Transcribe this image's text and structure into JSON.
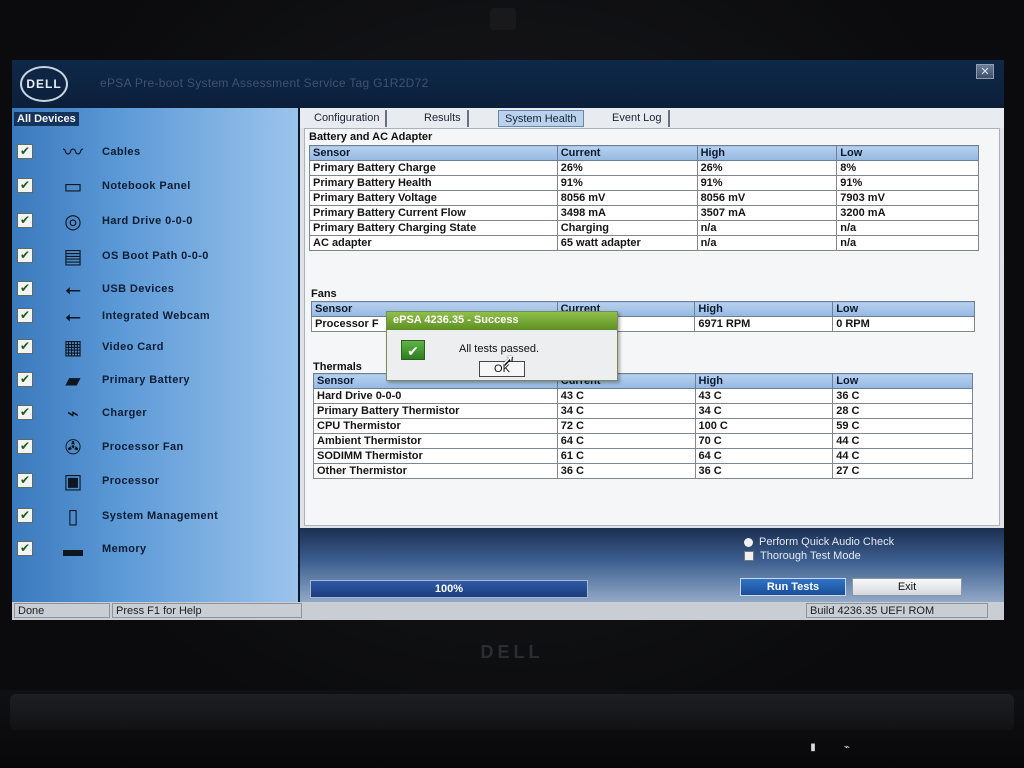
{
  "window": {
    "title": "ePSA Pre-boot System Assessment   Service Tag G1R2D72",
    "logo_text": "DELL",
    "close_icon": "close-icon"
  },
  "sidebar": {
    "header": "All Devices",
    "items": [
      {
        "label": "Cables",
        "icon": "cable-icon",
        "checked": true
      },
      {
        "label": "Notebook Panel",
        "icon": "notebook-panel-icon",
        "checked": true
      },
      {
        "label": "Hard Drive 0-0-0",
        "icon": "hard-drive-icon",
        "checked": true
      },
      {
        "label": "OS Boot Path 0-0-0",
        "icon": "boot-path-icon",
        "checked": true
      },
      {
        "label": "USB Devices",
        "icon": "usb-icon",
        "checked": true
      },
      {
        "label": "Integrated Webcam",
        "icon": "usb-icon",
        "checked": true
      },
      {
        "label": "Video Card",
        "icon": "video-card-icon",
        "checked": true
      },
      {
        "label": "Primary Battery",
        "icon": "battery-icon",
        "checked": true
      },
      {
        "label": "Charger",
        "icon": "charger-icon",
        "checked": true
      },
      {
        "label": "Processor Fan",
        "icon": "fan-icon",
        "checked": true
      },
      {
        "label": "Processor",
        "icon": "processor-icon",
        "checked": true
      },
      {
        "label": "System Management",
        "icon": "system-management-icon",
        "checked": true
      },
      {
        "label": "Memory",
        "icon": "memory-icon",
        "checked": true
      }
    ]
  },
  "tabs": [
    {
      "label": "Configuration",
      "active": false
    },
    {
      "label": "Results",
      "active": false
    },
    {
      "label": "System Health",
      "active": true
    },
    {
      "label": "Event Log",
      "active": false
    }
  ],
  "battery": {
    "title": "Battery and AC Adapter",
    "columns": [
      "Sensor",
      "Current",
      "High",
      "Low"
    ],
    "rows": [
      [
        "Primary Battery Charge",
        "26%",
        "26%",
        "8%"
      ],
      [
        "Primary Battery Health",
        "91%",
        "91%",
        "91%"
      ],
      [
        "Primary Battery Voltage",
        "8056 mV",
        "8056 mV",
        "7903 mV"
      ],
      [
        "Primary Battery Current Flow",
        "3498 mA",
        "3507 mA",
        "3200 mA"
      ],
      [
        "Primary Battery Charging State",
        "Charging",
        "n/a",
        "n/a"
      ],
      [
        "AC adapter",
        "65 watt adapter",
        "n/a",
        "n/a"
      ]
    ]
  },
  "fans": {
    "title": "Fans",
    "columns": [
      "Sensor",
      "Current",
      "High",
      "Low"
    ],
    "rows": [
      [
        "Processor F",
        "",
        "6971 RPM",
        "0 RPM"
      ]
    ]
  },
  "thermals": {
    "title": "Thermals",
    "columns": [
      "Sensor",
      "Current",
      "High",
      "Low"
    ],
    "rows": [
      [
        "Hard Drive 0-0-0",
        "43 C",
        "43 C",
        "36 C"
      ],
      [
        "Primary Battery Thermistor",
        "34 C",
        "34 C",
        "28 C"
      ],
      [
        "CPU Thermistor",
        "72 C",
        "100 C",
        "59 C"
      ],
      [
        "Ambient Thermistor",
        "64 C",
        "70 C",
        "44 C"
      ],
      [
        "SODIMM Thermistor",
        "61 C",
        "64 C",
        "44 C"
      ],
      [
        "Other Thermistor",
        "36 C",
        "36 C",
        "27 C"
      ]
    ]
  },
  "dialog": {
    "title": "ePSA 4236.35 - Success",
    "message": "All tests passed.",
    "ok_label": "OK",
    "icon": "success-check-icon"
  },
  "options": {
    "quick_audio": "Perform Quick Audio Check",
    "thorough": "Thorough Test Mode"
  },
  "progress": {
    "text": "100%",
    "value": 1.0
  },
  "buttons": {
    "run_tests": "Run Tests",
    "exit": "Exit"
  },
  "statusbar": {
    "state": "Done",
    "help": "Press F1 for Help",
    "build": "Build  4236.35 UEFI ROM"
  },
  "colors": {
    "accent": "#2f74c7",
    "success": "#5d8f22",
    "table_header": "#b7d1ef"
  }
}
